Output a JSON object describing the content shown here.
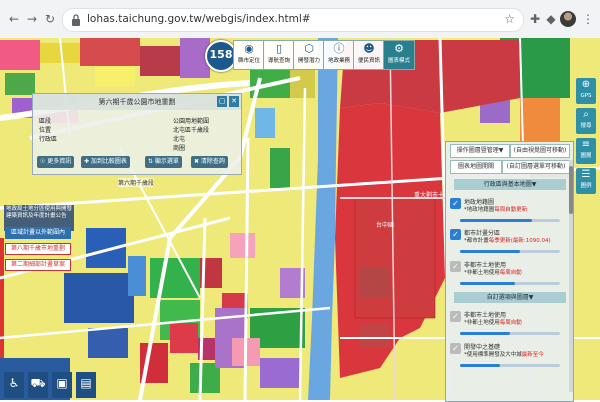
{
  "browser": {
    "url": "lohas.taichung.gov.tw/webgis/index.html#",
    "icons": [
      "back-icon",
      "forward-icon",
      "reload-icon",
      "lock-icon",
      "star-icon",
      "puzzle-icon",
      "extensions-icon",
      "menu-icon"
    ]
  },
  "toolbar": {
    "logo": "158",
    "buttons": [
      {
        "icon": "pin-icon",
        "label": "縣市定位"
      },
      {
        "icon": "phone-icon",
        "label": "導航查詢"
      },
      {
        "icon": "cube-icon",
        "label": "開發潛力"
      },
      {
        "icon": "info-icon",
        "label": "地政業務"
      },
      {
        "icon": "user-icon",
        "label": "便民資訊"
      },
      {
        "icon": "gear-icon",
        "label": "圖表模式"
      }
    ]
  },
  "side_buttons": [
    {
      "icon": "gps-icon",
      "label": "GPS"
    },
    {
      "icon": "search-icon",
      "label": "搜尋"
    },
    {
      "icon": "layers-icon",
      "label": "圖層"
    },
    {
      "icon": "legend-icon",
      "label": "圖例"
    }
  ],
  "query_panel": {
    "title": "第六期千歲公園市地重劃",
    "rows": [
      {
        "k": "區段",
        "v": "公園用地範圍"
      },
      {
        "k": "位置",
        "v": "北屯區千歲段"
      },
      {
        "k": "行政區",
        "v": "北屯"
      },
      {
        "k": "",
        "v": "商圈"
      }
    ],
    "buttons": [
      "☉ 更多資訊",
      "✚ 加到比較圖表",
      "⇅ 顯示選單",
      "✖ 清除查詢"
    ]
  },
  "map_labels": [
    "第六期千歲段",
    "重大劃市十期",
    "台中國"
  ],
  "left_notes": {
    "dark_text": "地政局土地分區使用與開發建築資訊及年度計畫公告",
    "chips": [
      {
        "label": "區域計畫以外範圍內",
        "selected": true
      },
      {
        "label": "第八期千歲市地重劃",
        "selected": false
      },
      {
        "label": "第二期細部計畫草案",
        "selected": false
      }
    ]
  },
  "bottom_icons": [
    "accessible-icon",
    "car-icon",
    "bus-icon",
    "document-icon"
  ],
  "layer_panel": {
    "tabs_top": [
      "操作圖層暨管理▼",
      "(自由視覺圖可移動)"
    ],
    "tabs_2": [
      "圖表地圖開關",
      "(自訂圖層選單可移動)"
    ],
    "section_admin": "行政區與基本地圖▼",
    "items_admin": [
      {
        "title": "地政地籍圖",
        "note1": "*地政地籍圖",
        "note2": "每周自動更新",
        "on": true
      },
      {
        "title": "都市計畫分區",
        "note1": "*都市計畫",
        "note2": "每季更新(最新:1090.04)",
        "on": true
      },
      {
        "title": "非都市土地使用",
        "note1": "*非都土地使用",
        "note2": "每周自動",
        "on": false
      }
    ],
    "section_custom": "自訂選項與圖層▼",
    "items_custom": [
      {
        "title": "非都市土地使用",
        "note1": "*非都土地使用",
        "note2": "每周自動",
        "on": false
      },
      {
        "title": "開發中之基礎",
        "note1": "*使用標準開發及大中城",
        "note2": "最新至今",
        "on": false
      }
    ]
  },
  "colors": {
    "teal": "#2e8fa7",
    "brand": "#1c5a8c",
    "commercial_red": "#d9363e",
    "residential_yellow": "#f4f06a"
  }
}
